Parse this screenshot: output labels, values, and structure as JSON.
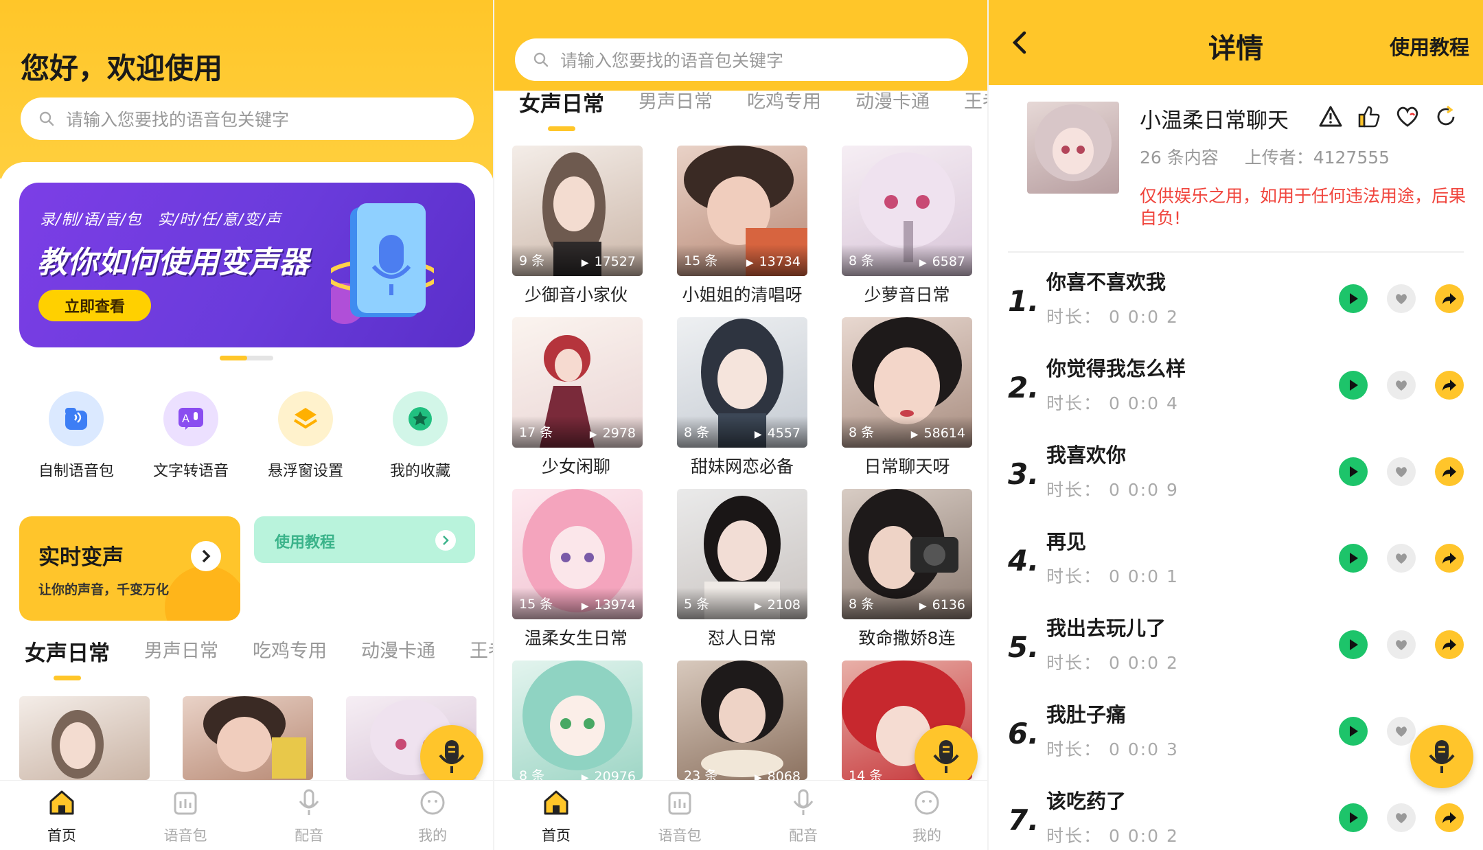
{
  "colors": {
    "brand_yellow": "#ffc629",
    "play_green": "#1dc46a",
    "warn_red": "#f0443c",
    "banner_purple": "#7c3ee6",
    "mint": "#b9f3dc"
  },
  "home": {
    "greeting": "您好，欢迎使用",
    "search_placeholder": "请输入您要找的语音包关键字",
    "banner": {
      "small_text": "录/制/语/音/包　实/时/任/意/变/声",
      "title": "教你如何使用变声器",
      "button": "立即查看"
    },
    "quick_actions": [
      {
        "label": "自制语音包",
        "icon": "voice-pack-icon"
      },
      {
        "label": "文字转语音",
        "icon": "text-to-speech-icon"
      },
      {
        "label": "悬浮窗设置",
        "icon": "floating-window-icon"
      },
      {
        "label": "我的收藏",
        "icon": "star-favorites-icon"
      }
    ],
    "realtime_card": {
      "title": "实时变声",
      "subtitle": "让你的声音，千变万化"
    },
    "tutorial_card": {
      "label": "使用教程"
    },
    "tabs": [
      "女声日常",
      "男声日常",
      "吃鸡专用",
      "动漫卡通",
      "王者荣"
    ]
  },
  "list": {
    "search_placeholder": "请输入您要找的语音包关键字",
    "tabs": [
      "女声日常",
      "男声日常",
      "吃鸡专用",
      "动漫卡通",
      "王者荣"
    ],
    "items": [
      {
        "name": "少御音小家伙",
        "count": "9 条",
        "plays": "17527"
      },
      {
        "name": "小姐姐的清唱呀",
        "count": "15 条",
        "plays": "13734"
      },
      {
        "name": "少萝音日常",
        "count": "8 条",
        "plays": "6587"
      },
      {
        "name": "少女闲聊",
        "count": "17 条",
        "plays": "2978"
      },
      {
        "name": "甜妹网恋必备",
        "count": "8 条",
        "plays": "4557"
      },
      {
        "name": "日常聊天呀",
        "count": "8 条",
        "plays": "58614"
      },
      {
        "name": "温柔女生日常",
        "count": "15 条",
        "plays": "13974"
      },
      {
        "name": "怼人日常",
        "count": "5 条",
        "plays": "2108"
      },
      {
        "name": "致命撒娇8连",
        "count": "8 条",
        "plays": "6136"
      },
      {
        "name": "",
        "count": "8 条",
        "plays": "20976"
      },
      {
        "name": "",
        "count": "23 条",
        "plays": "8068"
      },
      {
        "name": "",
        "count": "14 条",
        "plays": ""
      }
    ]
  },
  "nav": [
    {
      "label": "首页",
      "icon": "home-icon"
    },
    {
      "label": "语音包",
      "icon": "voice-pack-nav-icon"
    },
    {
      "label": "配音",
      "icon": "microphone-icon"
    },
    {
      "label": "我的",
      "icon": "profile-icon"
    }
  ],
  "detail": {
    "title": "详情",
    "tutorial": "使用教程",
    "pack_name": "小温柔日常聊天",
    "count": "26 条内容",
    "uploader": "上传者：4127555",
    "warning": "仅供娱乐之用，如用于任何违法用途，后果自负!",
    "clips": [
      {
        "num": "1.",
        "title": "你喜不喜欢我",
        "duration": "时长：  0 0:0 2"
      },
      {
        "num": "2.",
        "title": "你觉得我怎么样",
        "duration": "时长：  0 0:0 4"
      },
      {
        "num": "3.",
        "title": "我喜欢你",
        "duration": "时长：  0 0:0 9"
      },
      {
        "num": "4.",
        "title": "再见",
        "duration": "时长：  0 0:0 1"
      },
      {
        "num": "5.",
        "title": "我出去玩儿了",
        "duration": "时长：  0 0:0 2"
      },
      {
        "num": "6.",
        "title": "我肚子痛",
        "duration": "时长：  0 0:0 3"
      },
      {
        "num": "7.",
        "title": "该吃药了",
        "duration": "时长：  0 0:0 2"
      }
    ]
  }
}
